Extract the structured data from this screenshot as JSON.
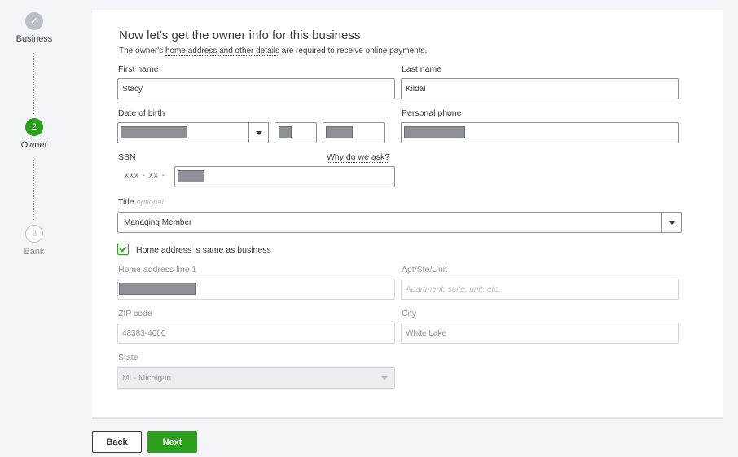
{
  "stepper": {
    "steps": [
      {
        "label": "Business",
        "marker": "✓",
        "state": "done"
      },
      {
        "label": "Owner",
        "marker": "2",
        "state": "active"
      },
      {
        "label": "Bank",
        "marker": "3",
        "state": "todo"
      }
    ]
  },
  "form": {
    "title": "Now let's get the owner info for this business",
    "subtitle_prefix": "The owner's ",
    "subtitle_link": "home address and other details",
    "subtitle_suffix": " are required to receive online payments.",
    "first_name": {
      "label": "First name",
      "value": "Stacy"
    },
    "last_name": {
      "label": "Last name",
      "value": "Kildal"
    },
    "dob": {
      "label": "Date of birth"
    },
    "phone": {
      "label": "Personal phone"
    },
    "ssn": {
      "label": "SSN",
      "help_link": "Why do we ask?",
      "prefix": "xxx - xx -"
    },
    "title_field": {
      "label": "Title",
      "optional": "optional",
      "value": "Managing Member"
    },
    "same_address": {
      "label": "Home address is same as business",
      "checked": true
    },
    "address1": {
      "label": "Home address line 1"
    },
    "apt": {
      "label": "Apt/Ste/Unit",
      "placeholder": "Apartment, suite, unit, etc."
    },
    "zip": {
      "label": "ZIP code",
      "value": "48383-4000"
    },
    "city": {
      "label": "City",
      "value": "White Lake"
    },
    "state": {
      "label": "State",
      "value": "MI - Michigan"
    }
  },
  "footer": {
    "back_label": "Back",
    "next_label": "Next"
  },
  "colors": {
    "accent": "#2ca01c",
    "muted": "#8d9096",
    "text": "#393a3d"
  }
}
